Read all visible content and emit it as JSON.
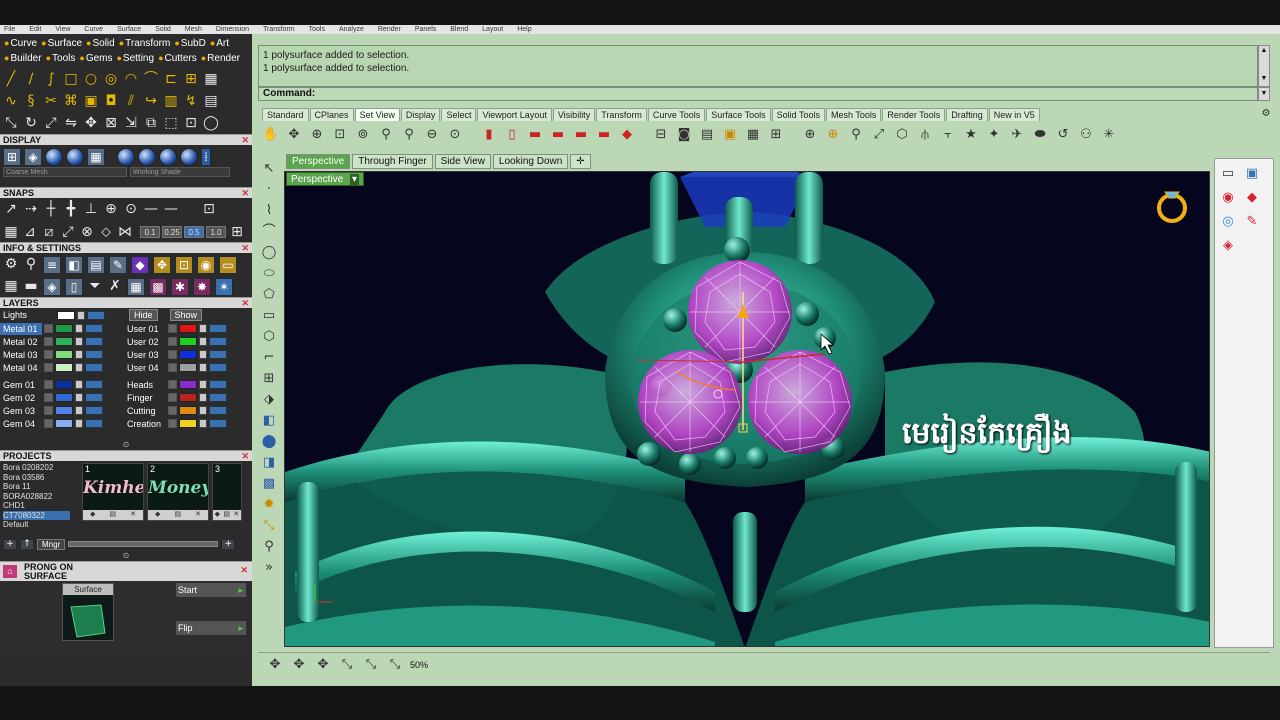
{
  "menubar": [
    "File",
    "Edit",
    "View",
    "Curve",
    "Surface",
    "Solid",
    "Mesh",
    "Dimension",
    "Transform",
    "Tools",
    "Analyze",
    "Render",
    "Panels",
    "Blend",
    "Layout",
    "Help"
  ],
  "toolbox_tabs": [
    "Curve",
    "Surface",
    "Solid",
    "Transform",
    "SubD",
    "Art",
    "Builder",
    "Tools",
    "Gems",
    "Setting",
    "Cutters",
    "Render"
  ],
  "display": {
    "title": "DISPLAY",
    "mesh_dropdown": "Coarse Mesh",
    "shade_dropdown": "Working Shade"
  },
  "snaps": {
    "title": "SNAPS",
    "values": [
      "0.1",
      "0.25",
      "0.5",
      "1.0"
    ]
  },
  "info": {
    "title": "INFO & SETTINGS"
  },
  "layers": {
    "title": "LAYERS",
    "lights_label": "Lights",
    "hide_label": "Hide",
    "show_label": "Show",
    "left_col": [
      {
        "name": "Metal 01",
        "color": "#1b9a4a",
        "selected": true
      },
      {
        "name": "Metal 02",
        "color": "#2fb25a"
      },
      {
        "name": "Metal 03",
        "color": "#7fdc7a"
      },
      {
        "name": "Metal 04",
        "color": "#c8efc4"
      },
      {
        "name": "Gem 01",
        "color": "#0a2fa0"
      },
      {
        "name": "Gem 02",
        "color": "#2b68d8"
      },
      {
        "name": "Gem 03",
        "color": "#4d86e8"
      },
      {
        "name": "Gem 04",
        "color": "#85b0f2"
      }
    ],
    "right_col": [
      {
        "name": "User 01",
        "color": "#e01515"
      },
      {
        "name": "User 02",
        "color": "#20d020"
      },
      {
        "name": "User 03",
        "color": "#1030e0"
      },
      {
        "name": "User 04",
        "color": "#a0a0a0"
      },
      {
        "name": "Heads",
        "color": "#8a2ad0"
      },
      {
        "name": "Finger",
        "color": "#b8241b"
      },
      {
        "name": "Cutting",
        "color": "#e08a10"
      },
      {
        "name": "Creation",
        "color": "#f0d020"
      }
    ]
  },
  "projects": {
    "title": "PROJECTS",
    "list": [
      "Bora 0208202",
      "Bora 03586",
      "Bora 11",
      "BORA028822",
      "CHD1",
      "CT7080322",
      "Default"
    ],
    "thumbs": [
      {
        "num": "1",
        "label": "Kimhea",
        "color": "#f4b9cf"
      },
      {
        "num": "2",
        "label": "Money",
        "color": "#7fdcb5"
      },
      {
        "num": "3",
        "label": "",
        "color": "#7fdcb5"
      }
    ],
    "mngr_label": "Mngr"
  },
  "prong": {
    "title": "PRONG ON SURFACE",
    "surface_label": "Surface",
    "start_label": "Start",
    "flip_label": "Flip"
  },
  "console": {
    "lines": [
      "1 polysurface added to selection.",
      "1 polysurface added to selection."
    ],
    "command_label": "Command:"
  },
  "toolbar_tabs": [
    "Standard",
    "CPlanes",
    "Set View",
    "Display",
    "Select",
    "Viewport Layout",
    "Visibility",
    "Transform",
    "Curve Tools",
    "Surface Tools",
    "Solid Tools",
    "Mesh Tools",
    "Render Tools",
    "Drafting",
    "New in V5"
  ],
  "active_toolbar_tab": "Set View",
  "viewport_tabs": [
    "Perspective",
    "Through Finger",
    "Side View",
    "Looking Down"
  ],
  "viewport_label": "Perspective",
  "overlay_text": "មេរៀនកែគ្រឿង",
  "status": {
    "zoom": "50%"
  },
  "colors": {
    "app_green": "#bcd7b5",
    "teal_metal": "#2aa58c",
    "gem_magenta": "#e040e8",
    "viewport_bg": "#05051e"
  }
}
